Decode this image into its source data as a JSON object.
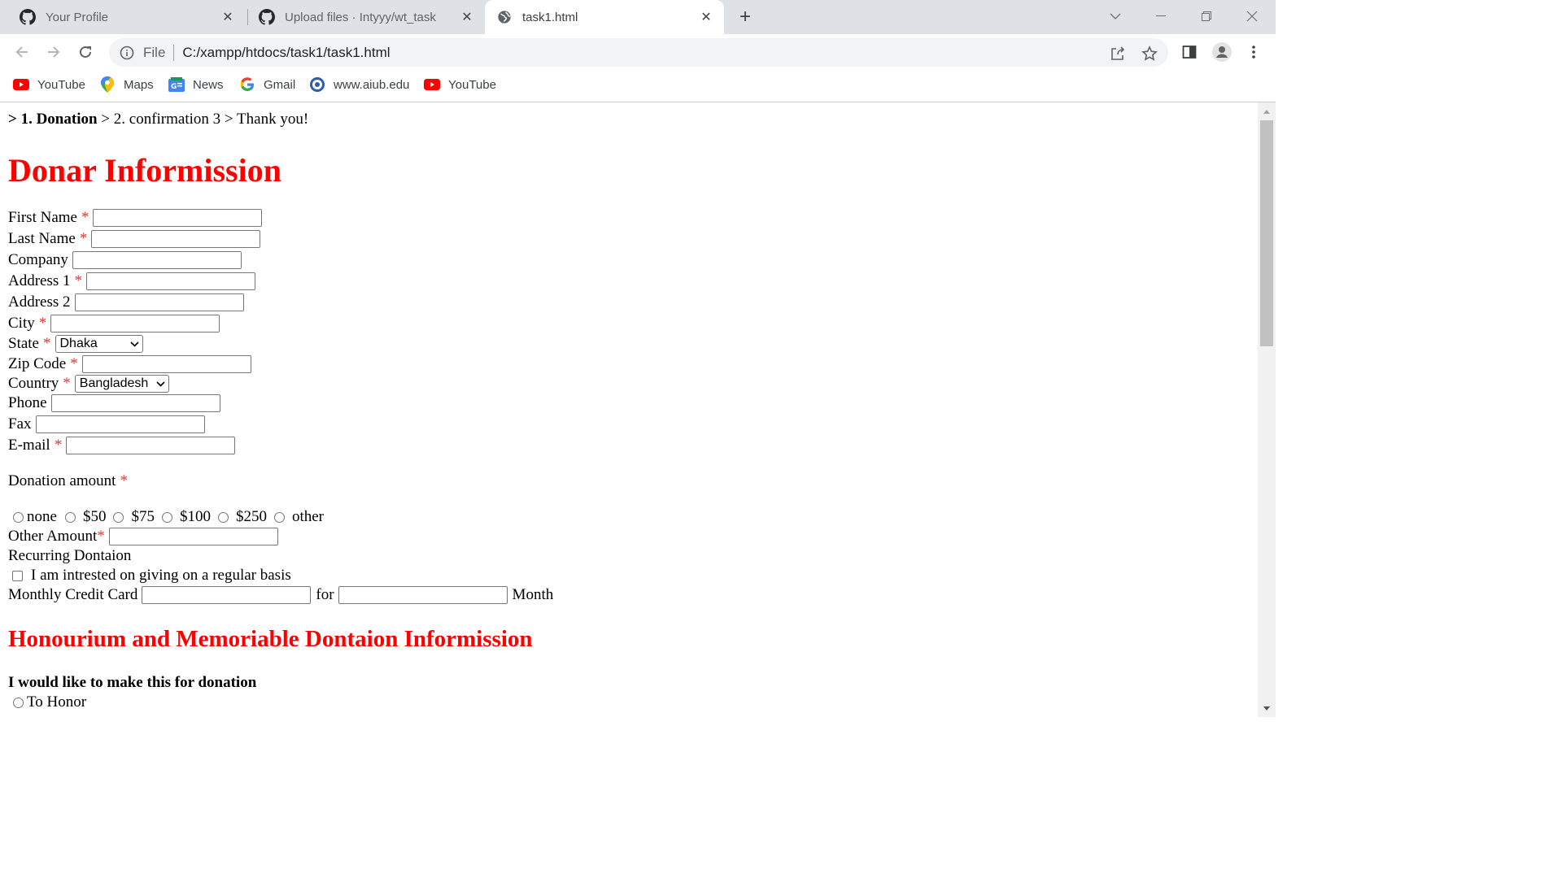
{
  "browser": {
    "tabs": [
      {
        "title": "Your Profile",
        "icon": "github-icon"
      },
      {
        "title": "Upload files · Intyyy/wt_task",
        "icon": "github-icon"
      },
      {
        "title": "task1.html",
        "icon": "globe-icon"
      }
    ],
    "omnibox": {
      "scheme_label": "File",
      "url": "C:/xampp/htdocs/task1/task1.html"
    },
    "bookmarks": [
      {
        "label": "YouTube",
        "icon": "youtube-icon"
      },
      {
        "label": "Maps",
        "icon": "maps-icon"
      },
      {
        "label": "News",
        "icon": "news-icon"
      },
      {
        "label": "Gmail",
        "icon": "google-icon"
      },
      {
        "label": "www.aiub.edu",
        "icon": "aiub-icon"
      },
      {
        "label": "YouTube",
        "icon": "youtube-icon"
      }
    ]
  },
  "page": {
    "breadcrumb": {
      "prefix": ">",
      "step1": "1. Donation",
      "sep1": ">",
      "step2": "2. confirmation",
      "step3_num": "3",
      "sep2": ">",
      "step3": "Thank you!"
    },
    "title": "Donar Informission",
    "required_mark": "*",
    "fields": {
      "first_name": "First Name",
      "last_name": "Last Name",
      "company": "Company",
      "address1": "Address 1",
      "address2": "Address 2",
      "city": "City",
      "state": "State",
      "state_value": "Dhaka",
      "zip": "Zip Code",
      "country": "Country",
      "country_value": "Bangladesh",
      "phone": "Phone",
      "fax": "Fax",
      "email": "E-mail"
    },
    "donation": {
      "label": "Donation amount",
      "options": [
        "none",
        "$50",
        "$75",
        "$100",
        "$250",
        "other"
      ],
      "other_amount": "Other Amount",
      "recurring": "Recurring Dontaion",
      "recurring_check": "I am intrested on giving on a regular basis",
      "monthly_card": "Monthly Credit Card",
      "for": "for",
      "month": "Month"
    },
    "section2_title": "Honourium and Memoriable Dontaion Informission",
    "make_for": "I would like to make this for donation",
    "to_honor": "To Honor"
  },
  "colors": {
    "heading": "#ff0000",
    "required": "#e53935",
    "tabstrip": "#dee1e6"
  }
}
